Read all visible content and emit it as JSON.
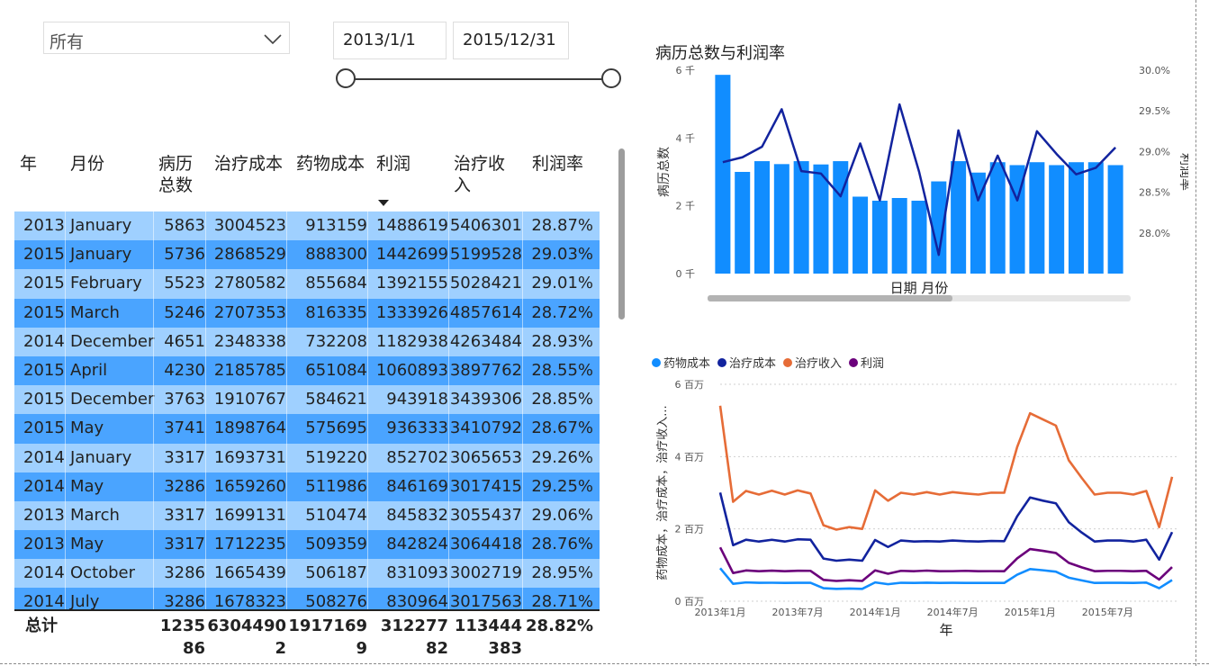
{
  "filter": {
    "selected": "所有"
  },
  "date_range": {
    "start": "2013/1/1",
    "end": "2015/12/31"
  },
  "table": {
    "headers": [
      "年",
      "月份",
      "病历\n总数",
      "治疗成本",
      "药物成本",
      "利润",
      "治疗收\n入",
      "利润率"
    ],
    "sorted_column": "利润",
    "rows": [
      [
        "2013",
        "January",
        "5863",
        "3004523",
        "913159",
        "1488619",
        "5406301",
        "28.87%"
      ],
      [
        "2015",
        "January",
        "5736",
        "2868529",
        "888300",
        "1442699",
        "5199528",
        "29.03%"
      ],
      [
        "2015",
        "February",
        "5523",
        "2780582",
        "855684",
        "1392155",
        "5028421",
        "29.01%"
      ],
      [
        "2015",
        "March",
        "5246",
        "2707353",
        "816335",
        "1333926",
        "4857614",
        "28.72%"
      ],
      [
        "2014",
        "December",
        "4651",
        "2348338",
        "732208",
        "1182938",
        "4263484",
        "28.93%"
      ],
      [
        "2015",
        "April",
        "4230",
        "2185785",
        "651084",
        "1060893",
        "3897762",
        "28.55%"
      ],
      [
        "2015",
        "December",
        "3763",
        "1910767",
        "584621",
        "943918",
        "3439306",
        "28.85%"
      ],
      [
        "2015",
        "May",
        "3741",
        "1898764",
        "575695",
        "936333",
        "3410792",
        "28.67%"
      ],
      [
        "2014",
        "January",
        "3317",
        "1693731",
        "519220",
        "852702",
        "3065653",
        "29.26%"
      ],
      [
        "2014",
        "May",
        "3286",
        "1659260",
        "511986",
        "846169",
        "3017415",
        "29.25%"
      ],
      [
        "2013",
        "March",
        "3317",
        "1699131",
        "510474",
        "845832",
        "3055437",
        "29.06%"
      ],
      [
        "2013",
        "May",
        "3317",
        "1712235",
        "509359",
        "842824",
        "3064418",
        "28.76%"
      ],
      [
        "2014",
        "October",
        "3286",
        "1665439",
        "506187",
        "831093",
        "3002719",
        "28.95%"
      ],
      [
        "2014",
        "July",
        "3286",
        "1678323",
        "508276",
        "830964",
        "3017563",
        "28.71%"
      ]
    ],
    "total": {
      "label": "总计",
      "values": [
        "1235\n86",
        "6304490\n2",
        "1917169\n9",
        "312277\n82",
        "113444\n383",
        "28.82%"
      ]
    }
  },
  "chart1": {
    "title": "病历总数与利润率",
    "xlabel": "日期 月份",
    "ylabel_left": "病历总数",
    "ylabel_right": "利润率",
    "left_ticks": [
      "0 千",
      "2 千",
      "4 千",
      "6 千"
    ],
    "right_ticks": [
      "28.0%",
      "28.5%",
      "29.0%",
      "29.5%",
      "30.0%"
    ]
  },
  "chart2": {
    "legend": [
      {
        "name": "药物成本",
        "color": "#118dff"
      },
      {
        "name": "治疗成本",
        "color": "#12239e"
      },
      {
        "name": "治疗收入",
        "color": "#e66c37"
      },
      {
        "name": "利润",
        "color": "#6b007b"
      }
    ],
    "ylabel": "药物成本，治疗成本，治疗收入...",
    "xlabel": "年",
    "y_ticks": [
      "0 百万",
      "2 百万",
      "4 百万",
      "6 百万"
    ],
    "x_ticks": [
      "2013年1月",
      "2013年7月",
      "2014年1月",
      "2014年7月",
      "2015年1月",
      "2015年7月"
    ]
  },
  "chart_data": [
    {
      "type": "bar",
      "title": "病历总数与利润率",
      "xlabel": "日期 月份",
      "ylabel": "病历总数",
      "ylim": [
        0,
        6000
      ],
      "y2lim": [
        27.5,
        30.0
      ],
      "series": [
        {
          "name": "病历总数",
          "values": [
            5863,
            3000,
            3317,
            3230,
            3317,
            3220,
            3317,
            2270,
            2150,
            2230,
            2150,
            2720,
            3317,
            2980,
            3286,
            3200,
            3286,
            3200,
            3286,
            3286,
            3200
          ]
        },
        {
          "name": "利润率",
          "axis": "right",
          "values": [
            28.87,
            28.93,
            29.06,
            29.52,
            28.76,
            28.73,
            28.45,
            29.1,
            28.4,
            29.58,
            28.75,
            27.73,
            29.26,
            28.4,
            28.95,
            28.4,
            29.25,
            28.97,
            28.72,
            28.8,
            29.05
          ]
        }
      ],
      "colors": {
        "bars": "#118dff",
        "line": "#12239e"
      }
    },
    {
      "type": "line",
      "xlabel": "年",
      "ylabel": "药物成本，治疗成本，治疗收入...",
      "ylim": [
        0,
        6000000
      ],
      "categories": [
        "2013年1月",
        "2013年7月",
        "2014年1月",
        "2014年7月",
        "2015年1月",
        "2015年7月"
      ],
      "series": [
        {
          "name": "治疗收入",
          "values": [
            5406301,
            2750000,
            3050000,
            2950000,
            3055437,
            2950000,
            3064418,
            2980000,
            2100000,
            1980000,
            2050000,
            2000000,
            3065653,
            2780000,
            3000000,
            2950000,
            3017415,
            2950000,
            3017563,
            2980000,
            2950000,
            3002719,
            3000000,
            4263484,
            5199528,
            5028421,
            4857614,
            3897762,
            3410792,
            2950000,
            3000000,
            3000000,
            2950000,
            3050000,
            2050000,
            3439306
          ]
        },
        {
          "name": "治疗成本",
          "values": [
            3004523,
            1550000,
            1700000,
            1650000,
            1699131,
            1650000,
            1712235,
            1700000,
            1180000,
            1120000,
            1150000,
            1120000,
            1693731,
            1500000,
            1680000,
            1650000,
            1659260,
            1650000,
            1678323,
            1660000,
            1650000,
            1665439,
            1660000,
            2348338,
            2868529,
            2780582,
            2707353,
            2185785,
            1898764,
            1650000,
            1680000,
            1680000,
            1650000,
            1700000,
            1150000,
            1910767
          ]
        },
        {
          "name": "利润",
          "values": [
            1488619,
            780000,
            850000,
            830000,
            845832,
            830000,
            842824,
            840000,
            590000,
            560000,
            580000,
            560000,
            852702,
            760000,
            840000,
            830000,
            846169,
            830000,
            830964,
            840000,
            830000,
            831093,
            830000,
            1182938,
            1442699,
            1392155,
            1333926,
            1060893,
            936333,
            830000,
            840000,
            840000,
            830000,
            840000,
            600000,
            943918
          ]
        },
        {
          "name": "药物成本",
          "values": [
            913159,
            480000,
            520000,
            510000,
            510474,
            505000,
            509359,
            510000,
            360000,
            340000,
            350000,
            340000,
            519220,
            470000,
            510000,
            505000,
            511986,
            505000,
            508276,
            505000,
            505000,
            506187,
            505000,
            732208,
            888300,
            855684,
            816335,
            651084,
            575695,
            505000,
            510000,
            510000,
            505000,
            515000,
            360000,
            584621
          ]
        }
      ]
    }
  ]
}
